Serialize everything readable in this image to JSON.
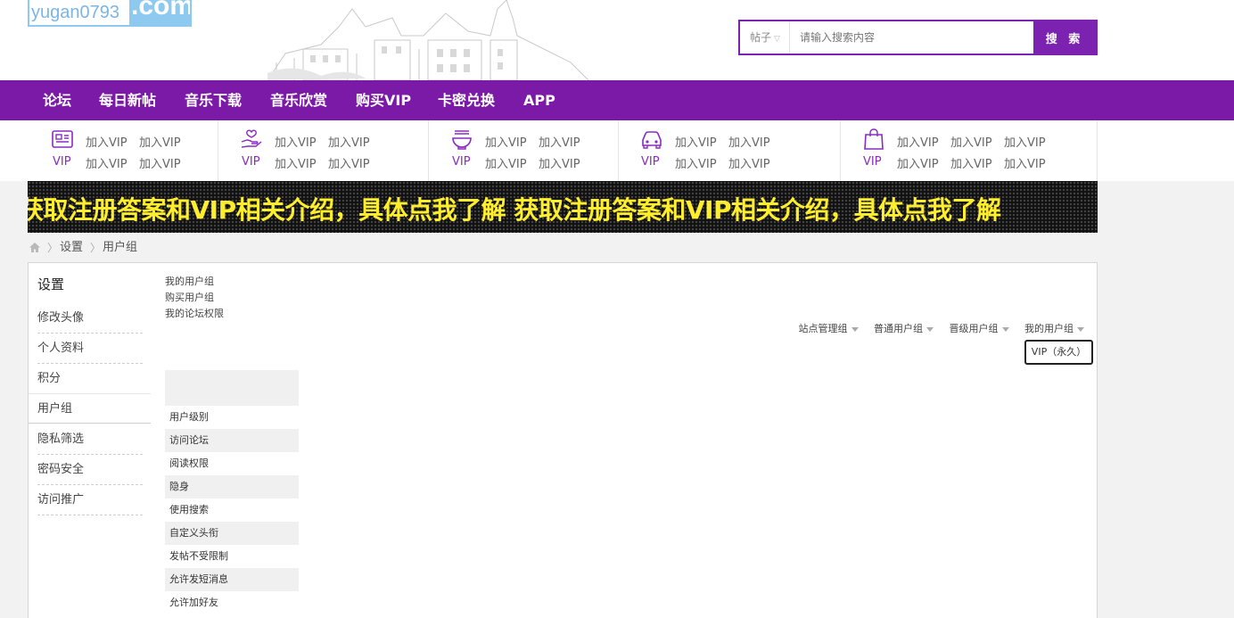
{
  "logo": {
    "text_left": "yugan0793",
    "text_right": ".com"
  },
  "search": {
    "type_label": "帖子",
    "placeholder": "请输入搜索内容",
    "button_label": "搜 索"
  },
  "nav": {
    "items": [
      "论坛",
      "每日新帖",
      "音乐下载",
      "音乐欣赏",
      "购买VIP",
      "卡密兑换",
      "APP"
    ]
  },
  "quick": {
    "cells": [
      {
        "icon": "news-icon",
        "vip_label": "VIP",
        "links": [
          "加入VIP",
          "加入VIP",
          "加入VIP",
          "加入VIP"
        ]
      },
      {
        "icon": "hand-heart-icon",
        "vip_label": "VIP",
        "links": [
          "加入VIP",
          "加入VIP",
          "加入VIP",
          "加入VIP"
        ]
      },
      {
        "icon": "food-bowl-icon",
        "vip_label": "VIP",
        "links": [
          "加入VIP",
          "加入VIP",
          "加入VIP",
          "加入VIP"
        ]
      },
      {
        "icon": "car-icon",
        "vip_label": "VIP",
        "links": [
          "加入VIP",
          "加入VIP",
          "加入VIP",
          "加入VIP"
        ]
      },
      {
        "icon": "shopping-bag-icon",
        "vip_label": "VIP",
        "links": [
          "加入VIP",
          "加入VIP",
          "加入VIP",
          "加入VIP",
          "加入VIP",
          "加入VIP"
        ]
      }
    ]
  },
  "marquee": {
    "text": "获取注册答案和VIP相关介绍，具体点我了解  获取注册答案和VIP相关介绍，具体点我了解"
  },
  "breadcrumb": {
    "items": [
      "设置",
      "用户组"
    ]
  },
  "sidebar": {
    "title": "设置",
    "items": [
      "修改头像",
      "个人资料",
      "积分",
      "用户组",
      "隐私筛选",
      "密码安全",
      "访问推广"
    ],
    "active": "用户组"
  },
  "sublinks": [
    "我的用户组",
    "购买用户组",
    "我的论坛权限"
  ],
  "group_tabs": [
    "站点管理组",
    "普通用户组",
    "晋级用户组",
    "我的用户组"
  ],
  "current_group": "VIP（永久）",
  "permissions": [
    "用户级别",
    "访问论坛",
    "阅读权限",
    "隐身",
    "使用搜索",
    "自定义头衔",
    "发帖不受限制",
    "允许发短消息",
    "允许加好友"
  ],
  "colors": {
    "brand": "#7c1aa8",
    "marquee_text": "#ffee2b"
  }
}
